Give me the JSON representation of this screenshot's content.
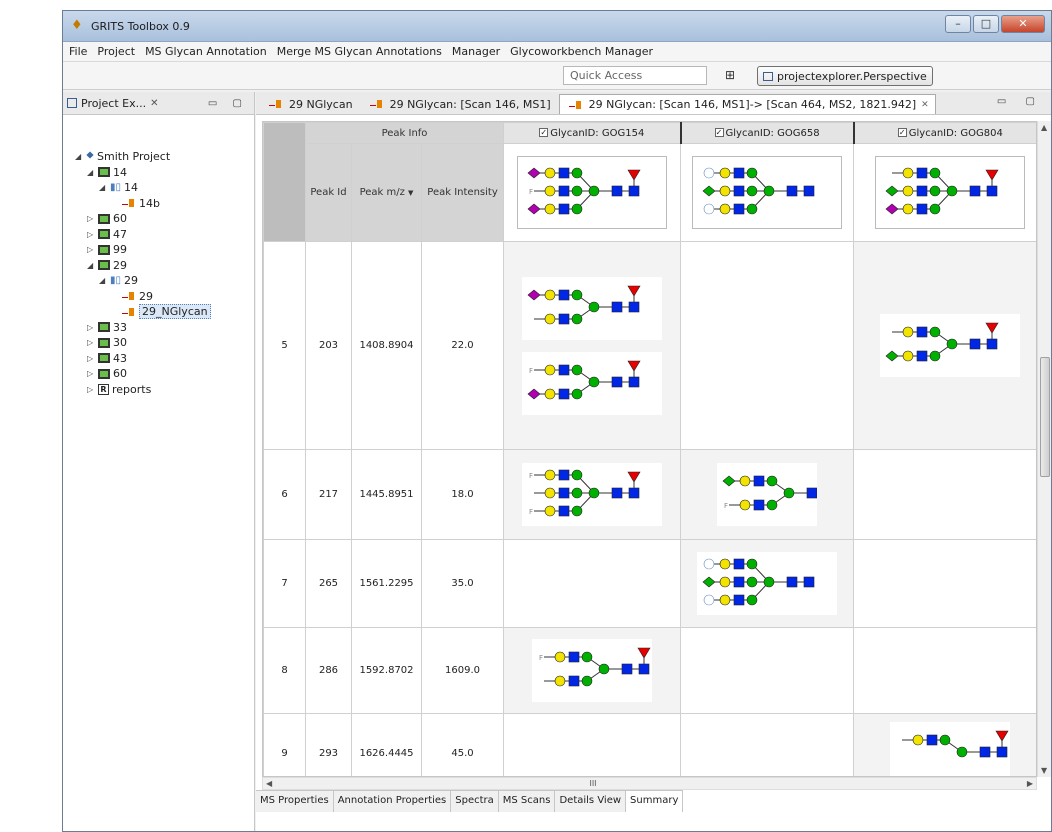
{
  "window": {
    "title": "GRITS Toolbox 0.9",
    "buttons": {
      "minimize": "–",
      "maximize": "□",
      "close": "✕"
    }
  },
  "menu": [
    "File",
    "Project",
    "MS Glycan Annotation",
    "Merge MS Glycan Annotations",
    "Manager",
    "Glycoworkbench Manager"
  ],
  "toolbar": {
    "quick_access_placeholder": "Quick Access",
    "perspective_label": "projectexplorer.Perspective"
  },
  "explorer": {
    "tab_label": "Project Ex...",
    "tab_close": "✕",
    "tree": [
      {
        "label": "Smith Project",
        "level": 0,
        "icon": "project-icon",
        "twisty": "◢"
      },
      {
        "label": "14",
        "level": 1,
        "icon": "experiment-icon",
        "twisty": "◢"
      },
      {
        "label": "14",
        "level": 2,
        "icon": "ms-scan-icon",
        "twisty": "◢"
      },
      {
        "label": "14b",
        "level": 3,
        "icon": "annotation-icon",
        "twisty": ""
      },
      {
        "label": "60",
        "level": 1,
        "icon": "experiment-icon",
        "twisty": "▷"
      },
      {
        "label": "47",
        "level": 1,
        "icon": "experiment-icon",
        "twisty": "▷"
      },
      {
        "label": "99",
        "level": 1,
        "icon": "experiment-icon",
        "twisty": "▷"
      },
      {
        "label": "29",
        "level": 1,
        "icon": "experiment-icon",
        "twisty": "◢"
      },
      {
        "label": "29",
        "level": 2,
        "icon": "ms-scan-icon",
        "twisty": "◢"
      },
      {
        "label": "29",
        "level": 3,
        "icon": "annotation-icon",
        "twisty": ""
      },
      {
        "label": "29_NGlycan",
        "level": 3,
        "icon": "annotation-icon",
        "twisty": "",
        "selected": true
      },
      {
        "label": "33",
        "level": 1,
        "icon": "experiment-icon",
        "twisty": "▷"
      },
      {
        "label": "30",
        "level": 1,
        "icon": "experiment-icon",
        "twisty": "▷"
      },
      {
        "label": "43",
        "level": 1,
        "icon": "experiment-icon",
        "twisty": "▷"
      },
      {
        "label": "60",
        "level": 1,
        "icon": "experiment-icon",
        "twisty": "▷"
      },
      {
        "label": "reports",
        "level": 1,
        "icon": "reports-icon",
        "twisty": "▷"
      }
    ]
  },
  "editor": {
    "tabs": [
      {
        "label": "29 NGlycan",
        "active": false
      },
      {
        "label": "29 NGlycan: [Scan 146, MS1]",
        "active": false
      },
      {
        "label": "29 NGlycan: [Scan 146, MS1]-> [Scan 464, MS2, 1821.942]",
        "active": true,
        "close": "✕"
      }
    ],
    "table": {
      "peak_info_header": "Peak Info",
      "col_peak_id": "Peak Id",
      "col_peak_mz": "Peak m/z",
      "col_peak_intensity": "Peak Intensity",
      "sort_indicator": "▼",
      "checkbox_mark": "✓",
      "glycans": [
        {
          "label": "GlycanID: GOG154"
        },
        {
          "label": "GlycanID: GOG658"
        },
        {
          "label": "GlycanID: GOG804"
        }
      ],
      "rows": [
        {
          "index": "5",
          "peak_id": "203",
          "mz": "1408.8904",
          "intensity": "22.0"
        },
        {
          "index": "6",
          "peak_id": "217",
          "mz": "1445.8951",
          "intensity": "18.0"
        },
        {
          "index": "7",
          "peak_id": "265",
          "mz": "1561.2295",
          "intensity": "35.0"
        },
        {
          "index": "8",
          "peak_id": "286",
          "mz": "1592.8702",
          "intensity": "1609.0"
        },
        {
          "index": "9",
          "peak_id": "293",
          "mz": "1626.4445",
          "intensity": "45.0"
        }
      ]
    },
    "h_scroll_mark": "III",
    "bottom_tabs": [
      {
        "label": "MS Properties",
        "active": false
      },
      {
        "label": "Annotation Properties",
        "active": false
      },
      {
        "label": "Spectra",
        "active": false
      },
      {
        "label": "MS Scans",
        "active": false
      },
      {
        "label": "Details View",
        "active": false
      },
      {
        "label": "Summary",
        "active": true
      }
    ]
  },
  "colors": {
    "mannose": "#f2e400",
    "glcnac": "#0026e6",
    "fucose": "#e60000",
    "galactose": "#00b000",
    "sialic": "#b000b0"
  }
}
